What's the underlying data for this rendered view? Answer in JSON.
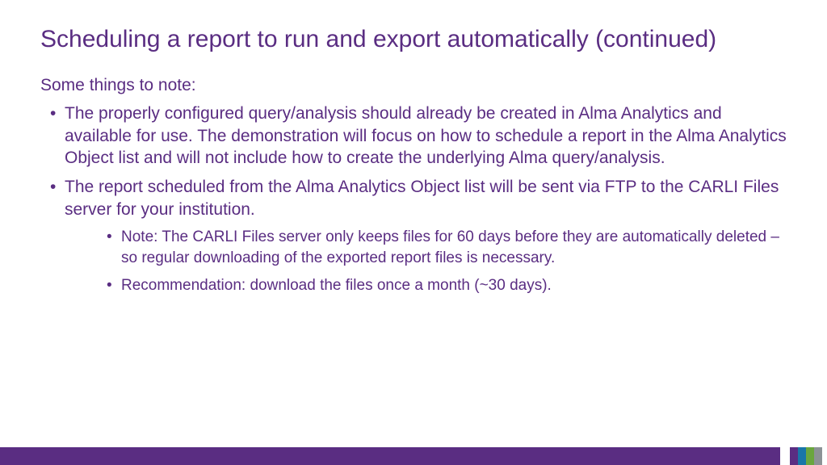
{
  "title": "Scheduling a report to run and export automatically (continued)",
  "intro": "Some things to note:",
  "bullets": [
    {
      "text": "The properly configured query/analysis should already be created in Alma Analytics and available for use.  The demonstration will focus on how to schedule a report in the Alma Analytics Object list and will not include how to create the underlying Alma query/analysis."
    },
    {
      "text": "The report scheduled from the Alma Analytics Object list will be sent via FTP to the CARLI Files server for your institution.",
      "sub": [
        "Note: The CARLI Files server only keeps files for 60 days before they are automatically deleted – so regular downloading of the exported report files is necessary.",
        "Recommendation: download the files once a month (~30 days)."
      ]
    }
  ]
}
